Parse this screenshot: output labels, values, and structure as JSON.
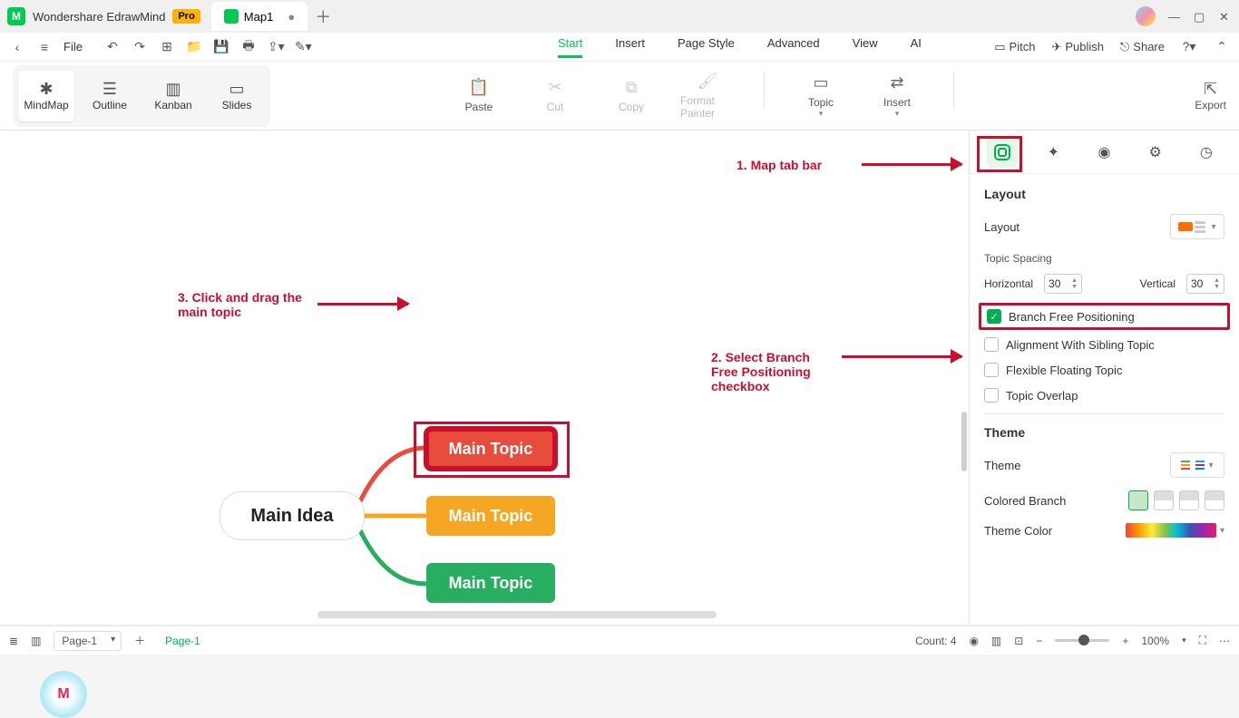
{
  "titlebar": {
    "app_name": "Wondershare EdrawMind",
    "badge": "Pro",
    "doc_tab": "Map1"
  },
  "menubar": {
    "file": "File",
    "tabs": [
      "Start",
      "Insert",
      "Page Style",
      "Advanced",
      "View",
      "AI"
    ],
    "active_tab": "Start",
    "pitch": "Pitch",
    "publish": "Publish",
    "share": "Share"
  },
  "ribbon": {
    "views": [
      "MindMap",
      "Outline",
      "Kanban",
      "Slides"
    ],
    "active_view": "MindMap",
    "paste": "Paste",
    "cut": "Cut",
    "copy": "Copy",
    "format_painter": "Format Painter",
    "topic": "Topic",
    "insert": "Insert",
    "export": "Export"
  },
  "mindmap": {
    "main_idea": "Main Idea",
    "topics": [
      "Main Topic",
      "Main Topic",
      "Main Topic"
    ]
  },
  "annotations": {
    "a1": "1. Map tab bar",
    "a2": "2. Select Branch Free Positioning checkbox",
    "a3": "3. Click and drag the main topic"
  },
  "rpanel": {
    "layout_title": "Layout",
    "layout_label": "Layout",
    "topic_spacing": "Topic Spacing",
    "horizontal": "Horizontal",
    "horizontal_val": "30",
    "vertical": "Vertical",
    "vertical_val": "30",
    "branch_free": "Branch Free Positioning",
    "align_sibling": "Alignment With Sibling Topic",
    "flex_floating": "Flexible Floating Topic",
    "topic_overlap": "Topic Overlap",
    "theme_title": "Theme",
    "theme_label": "Theme",
    "colored_branch": "Colored Branch",
    "theme_color": "Theme Color"
  },
  "statusbar": {
    "page_dd": "Page-1",
    "page_tab": "Page-1",
    "count": "Count: 4",
    "zoom": "100%"
  }
}
